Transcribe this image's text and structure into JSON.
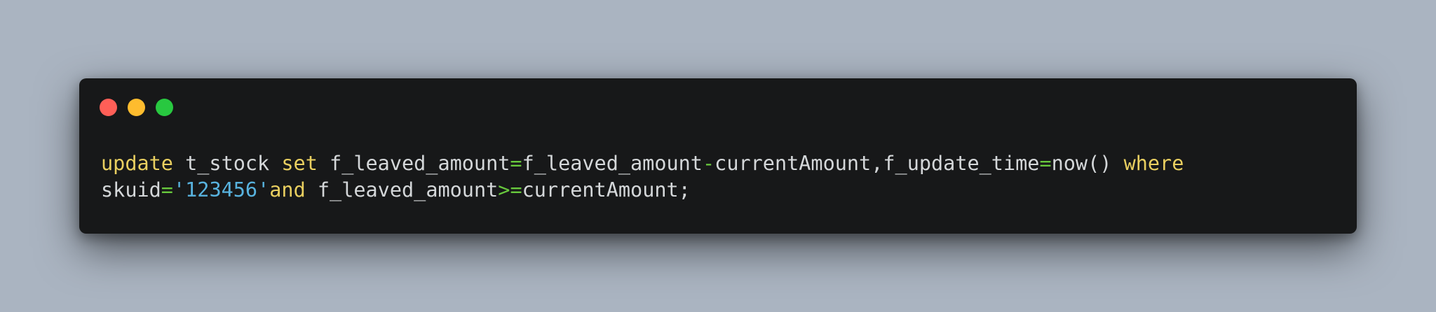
{
  "colors": {
    "background": "#aab4c1",
    "window": "#171819",
    "text": "#d4d7d9",
    "keyword": "#e9cf60",
    "operator": "#68c93d",
    "string": "#58b3df",
    "close": "#ff5f57",
    "minimize": "#febc2e",
    "maximize": "#28c840"
  },
  "window_controls": [
    {
      "name": "close",
      "icon": "red-circle"
    },
    {
      "name": "minimize",
      "icon": "yellow-circle"
    },
    {
      "name": "maximize",
      "icon": "green-circle"
    }
  ],
  "code": {
    "line1": [
      {
        "t": "update",
        "k": "keyword"
      },
      {
        "t": " t_stock ",
        "k": "text"
      },
      {
        "t": "set",
        "k": "keyword"
      },
      {
        "t": " f_leaved_amount",
        "k": "text"
      },
      {
        "t": "=",
        "k": "operator"
      },
      {
        "t": "f_leaved_amount",
        "k": "text"
      },
      {
        "t": "-",
        "k": "operator"
      },
      {
        "t": "currentAmount,f_update_time",
        "k": "text"
      },
      {
        "t": "=",
        "k": "operator"
      },
      {
        "t": "now() ",
        "k": "text"
      },
      {
        "t": "where",
        "k": "keyword"
      }
    ],
    "line2": [
      {
        "t": "skuid",
        "k": "text"
      },
      {
        "t": "=",
        "k": "operator"
      },
      {
        "t": "'123456'",
        "k": "string"
      },
      {
        "t": "and",
        "k": "keyword"
      },
      {
        "t": " f_leaved_amount",
        "k": "text"
      },
      {
        "t": ">=",
        "k": "operator"
      },
      {
        "t": "currentAmount;",
        "k": "text"
      }
    ]
  }
}
